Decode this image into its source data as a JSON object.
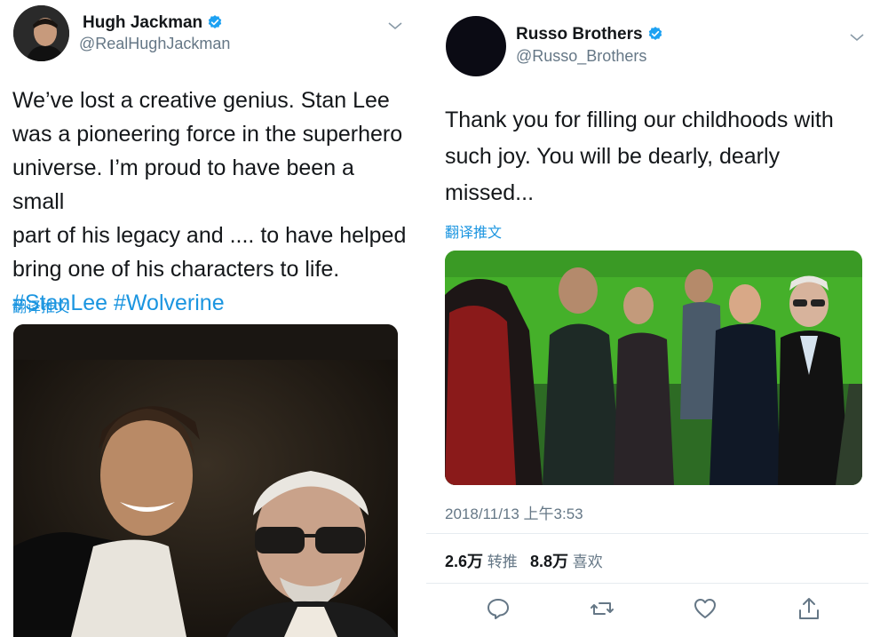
{
  "left_tweet": {
    "author_name": "Hugh Jackman",
    "author_handle": "@RealHughJackman",
    "text_lines": [
      "We’ve lost a creative genius. Stan Lee",
      "was a pioneering force in the superhero",
      "universe. I’m proud to have been a small",
      "part of his legacy and .... to have helped",
      "bring one of his characters to life."
    ],
    "hashtags": [
      "#StanLee",
      "#Wolverine"
    ],
    "translate_label": "翻译推文",
    "photo_icon": "photo-hugh-jackman-and-stan-lee"
  },
  "right_tweet": {
    "author_name": "Russo Brothers",
    "author_handle": "@Russo_Brothers",
    "text_lines": [
      "Thank you for filling our childhoods with",
      "such joy. You will be dearly, dearly",
      "missed..."
    ],
    "translate_label": "翻译推文",
    "photo_icon": "photo-cast-with-stan-lee-on-set",
    "timestamp": "2018/11/13 上午3:53",
    "retweet_count": "2.6万",
    "retweet_label": "转推",
    "like_count": "8.8万",
    "like_label": "喜欢"
  },
  "colors": {
    "link": "#1b95e0",
    "secondary_text": "#657786",
    "verified": "#1da1f2"
  }
}
